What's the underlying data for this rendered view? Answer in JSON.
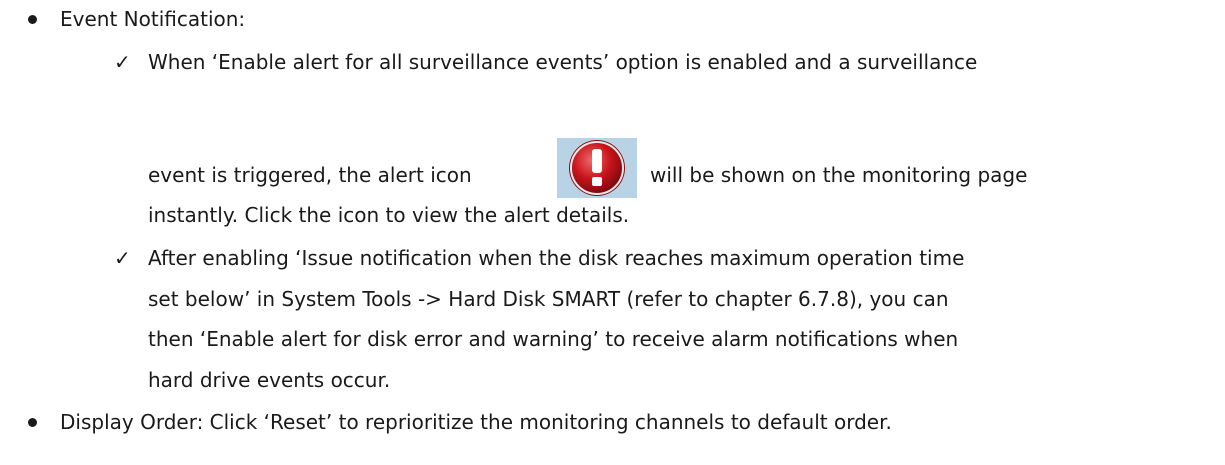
{
  "doc": {
    "event_notification": {
      "heading": "Event Notification:",
      "item1": {
        "check": "✓",
        "line1": "When ‘Enable alert for all surveillance events’ option is enabled and a surveillance",
        "line2_before_icon": "event is triggered, the alert icon",
        "line2_after_icon": "will be shown on the monitoring page",
        "line3": "instantly.   Click the icon to view the alert details."
      },
      "item2": {
        "check": "✓",
        "line1": "After enabling ‘Issue notification when the disk reaches maximum operation time",
        "line2": "set below’ in System Tools -> Hard Disk SMART (refer to chapter 6.7.8), you can",
        "line3": "then ‘Enable alert for disk error and warning’ to receive alarm notifications when",
        "line4": "hard drive events occur."
      }
    },
    "display_order": {
      "text": "Display Order: Click ‘Reset’ to reprioritize the monitoring channels to default order."
    }
  },
  "icons": {
    "alert": "alert-exclamation-icon"
  },
  "colors": {
    "text": "#1a1a1a",
    "alert_red": "#c8141b",
    "alert_bg": "#b9d3e6"
  }
}
